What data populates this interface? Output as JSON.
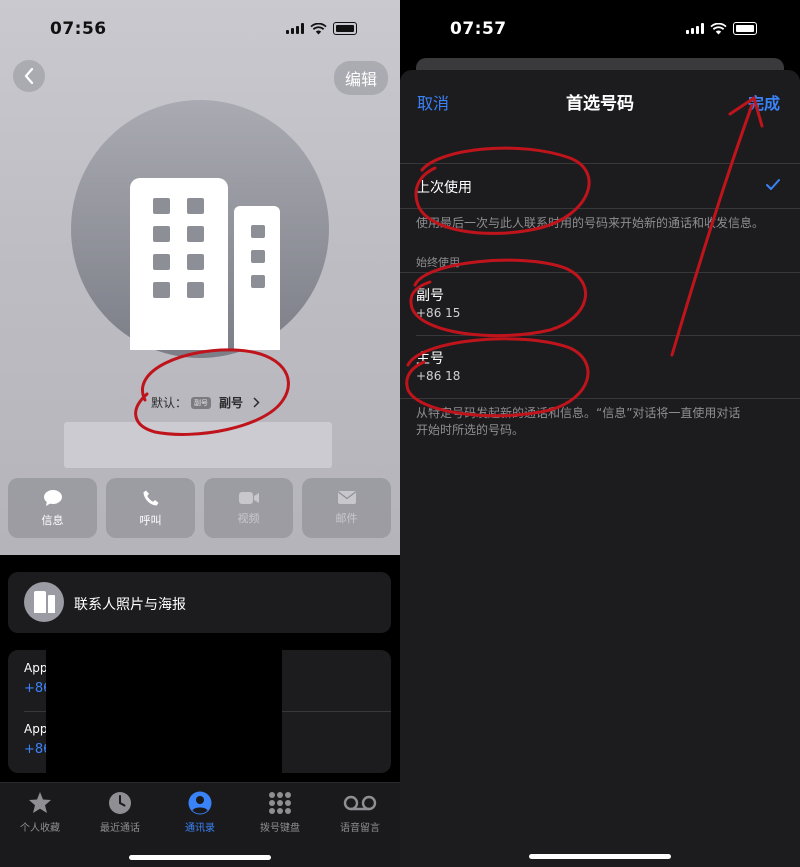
{
  "left": {
    "status_time": "07:56",
    "back_icon": "chevron-left-icon",
    "edit_label": "编辑",
    "default_prefix": "默认：",
    "default_badge": "副号",
    "default_value": "副号",
    "actions": [
      {
        "label": "信息",
        "icon": "message-bubble-icon",
        "enabled": true
      },
      {
        "label": "呼叫",
        "icon": "phone-icon",
        "enabled": true
      },
      {
        "label": "视频",
        "icon": "video-camera-icon",
        "enabled": false
      },
      {
        "label": "邮件",
        "icon": "mail-icon",
        "enabled": false
      }
    ],
    "contact_poster_label": "联系人照片与海报",
    "phones": [
      {
        "label": "App",
        "number": "+86"
      },
      {
        "label": "App",
        "number": "+86"
      }
    ],
    "tabs": [
      {
        "label": "个人收藏",
        "icon": "star-icon",
        "active": false
      },
      {
        "label": "最近通话",
        "icon": "clock-icon",
        "active": false
      },
      {
        "label": "通讯录",
        "icon": "person-circle-icon",
        "active": true
      },
      {
        "label": "拨号键盘",
        "icon": "keypad-icon",
        "active": false
      },
      {
        "label": "语音留言",
        "icon": "voicemail-icon",
        "active": false
      }
    ]
  },
  "right": {
    "status_time": "07:57",
    "cancel_label": "取消",
    "title": "首选号码",
    "done_label": "完成",
    "last_used_label": "上次使用",
    "last_used_desc": "使用最后一次与此人联系时用的号码来开始新的通话和收发信息。",
    "always_use_header": "始终使用",
    "options": [
      {
        "label": "副号",
        "number": "+86 15"
      },
      {
        "label": "主号",
        "number": "+86 18"
      }
    ],
    "footer_desc_line1": "从特定号码发起新的通话和信息。“信息”对话将一直使用对话",
    "footer_desc_line2": "开始时所选的号码。"
  },
  "colors": {
    "accent": "#3a82f7",
    "annotation": "#c0141c",
    "sheet_bg": "#1c1c1e"
  }
}
